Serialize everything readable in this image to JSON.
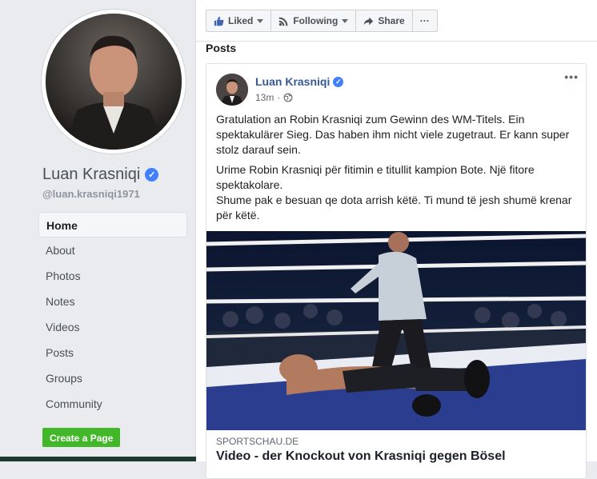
{
  "profile": {
    "name": "Luan Krasniqi",
    "handle": "@luan.krasniqi1971",
    "verified_icon": "verified-badge-icon"
  },
  "nav": {
    "items": [
      {
        "label": "Home",
        "active": true
      },
      {
        "label": "About"
      },
      {
        "label": "Photos"
      },
      {
        "label": "Notes"
      },
      {
        "label": "Videos"
      },
      {
        "label": "Posts"
      },
      {
        "label": "Groups"
      },
      {
        "label": "Community"
      }
    ],
    "create_page": "Create a Page"
  },
  "actions": {
    "liked": "Liked",
    "following": "Following",
    "share": "Share",
    "more": "···"
  },
  "posts": {
    "section_title": "Posts",
    "post": {
      "author": "Luan Krasniqi",
      "time": "13m",
      "more": "•••",
      "paragraph_de": "Gratulation an Robin Krasniqi zum Gewinn des WM-Titels. Ein spektakulärer Sieg. Das haben ihm nicht viele zugetraut. Er kann super stolz darauf sein.",
      "paragraph_sq_1": "Urime Robin Krasniqi për fitimin e titullit kampion Bote. Një fitore spektakolare.",
      "paragraph_sq_2": "Shume pak e besuan qe dota arrish këtë. Ti mund të jesh shumë krenar për këtë.",
      "link_source": "SPORTSCHAU.DE",
      "link_title": "Video - der Knockout von Krasniqi gegen Bösel"
    }
  },
  "colors": {
    "link_blue": "#365899",
    "verified_blue": "#4080ff",
    "create_green": "#42b72a"
  }
}
